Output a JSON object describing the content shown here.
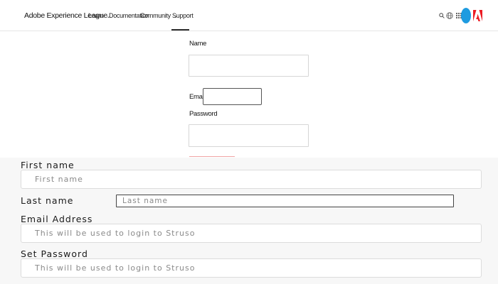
{
  "header": {
    "brand": "Adobe Experience League",
    "nav": [
      {
        "label": "Learn",
        "chevron": true
      },
      {
        "label": "Documentation",
        "chevron": false
      },
      {
        "label": "Community",
        "chevron": true
      },
      {
        "label": "Support",
        "chevron": false
      }
    ],
    "active_nav": "Support",
    "icons": [
      "search-icon",
      "globe-icon",
      "apps-grid-icon",
      "avatar",
      "adobe-logo"
    ],
    "accent_color": "#1e9be0",
    "brand_color": "#ec1c24"
  },
  "top_form": {
    "name_label": "Name",
    "email_label": "Email",
    "password_label": "Password"
  },
  "registration": {
    "first_name_label": "First name",
    "first_name_placeholder": "First name",
    "last_name_label": "Last name",
    "last_name_placeholder": "Last name",
    "email_label": "Email Address",
    "email_placeholder": "This will be used to login to Struso",
    "password_label": "Set Password",
    "password_placeholder": "This will be used to login to Struso"
  }
}
